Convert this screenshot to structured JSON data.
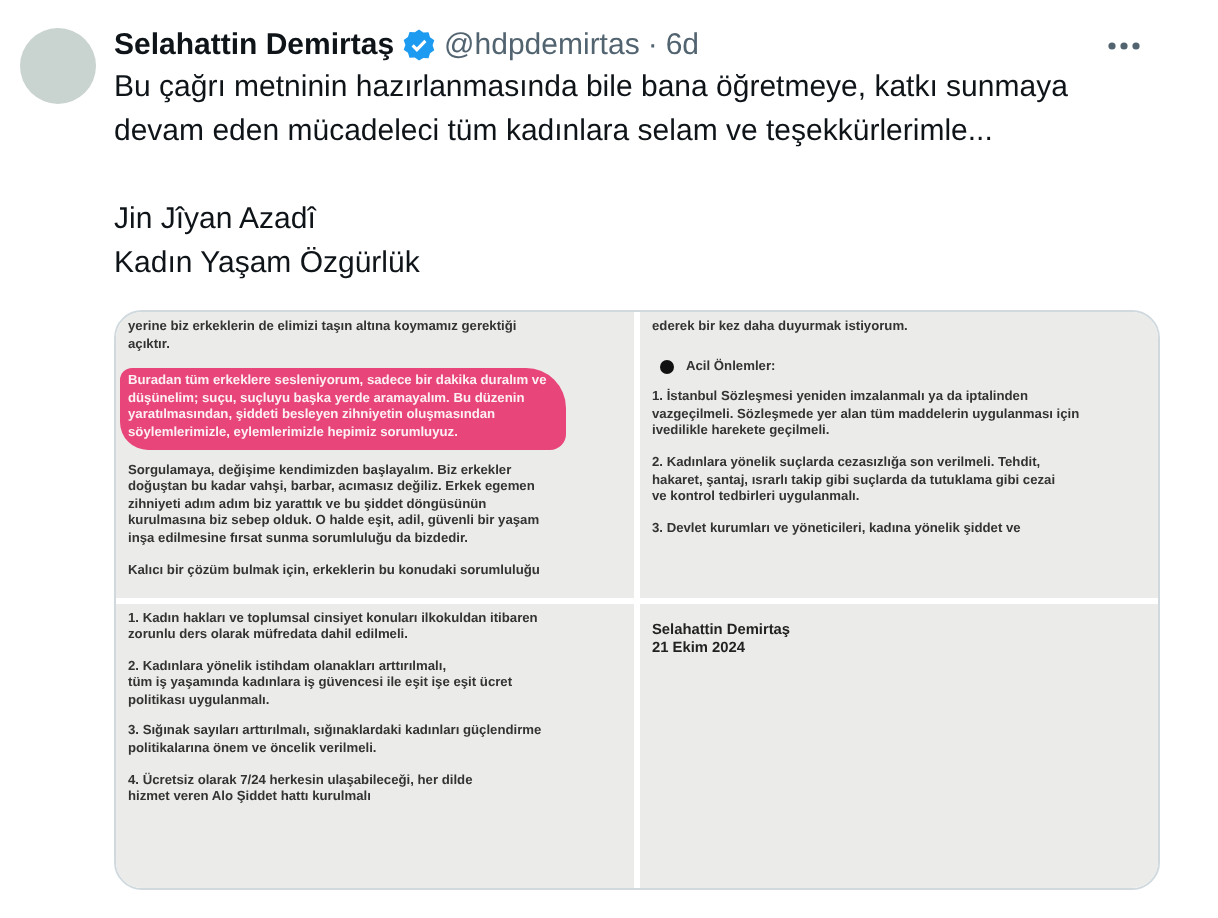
{
  "author": {
    "name": "Selahattin Demirtaş",
    "verified": true,
    "handle": "@hdpdemirtas",
    "separator": "·",
    "time": "6d"
  },
  "text": [
    [
      "Bu çağrı metninin hazırlanmasında bile bana öğretmeye, katkı sunmaya devam eden mücadeleci tüm kadınlara selam ve teşekkürlerimle..."
    ],
    [
      "Jin Jîyan Azadî",
      "Kadın Yaşam Özgürlük"
    ]
  ],
  "media": {
    "panels": [
      {
        "paragraphs": [
          {
            "kind": "text",
            "lines": [
              "yerine biz erkeklerin de elimizi taşın altına koymamız gerektiği",
              "açıktır."
            ]
          },
          {
            "kind": "highlight",
            "lines": [
              "Buradan tüm erkeklere sesleniyorum, sadece bir dakika duralım ve",
              "düşünelim; suçu, suçluyu başka yerde aramayalım. Bu düzenin",
              "yaratılmasından, şiddeti besleyen zihniyetin oluşmasından",
              "söylemlerimizle, eylemlerimizle hepimiz sorumluyuz."
            ]
          },
          {
            "kind": "text",
            "lines": [
              "Sorgulamaya, değişime kendimizden başlayalım. Biz erkekler",
              "doğuştan bu kadar vahşi, barbar, acımasız değiliz. Erkek egemen",
              "zihniyeti adım adım biz yarattık ve bu şiddet döngüsünün",
              "kurulmasına biz sebep olduk. O halde eşit, adil, güvenli bir yaşam",
              "inşa edilmesine fırsat sunma sorumluluğu da bizdedir."
            ]
          },
          {
            "kind": "text",
            "lines": [
              "Kalıcı bir çözüm bulmak için, erkeklerin bu konudaki sorumluluğu"
            ]
          }
        ]
      },
      {
        "paragraphs": [
          {
            "kind": "text",
            "lines": [
              "ederek bir kez daha duyurmak istiyorum."
            ]
          },
          {
            "kind": "bullet",
            "lines": [
              "Acil Önlemler:"
            ]
          },
          {
            "kind": "text",
            "lines": [
              "1. İstanbul Sözleşmesi yeniden imzalanmalı ya da iptalinden",
              "vazgeçilmeli. Sözleşmede yer alan tüm maddelerin uygulanması için",
              "ivedilikle harekete geçilmeli."
            ]
          },
          {
            "kind": "text",
            "lines": [
              "2. Kadınlara yönelik suçlarda cezasızlığa son verilmeli. Tehdit,",
              "hakaret, şantaj, ısrarlı takip gibi suçlarda da tutuklama gibi cezai",
              "ve kontrol tedbirleri uygulanmalı."
            ]
          },
          {
            "kind": "text",
            "lines": [
              "3. Devlet kurumları ve yöneticileri, kadına yönelik şiddet ve"
            ]
          }
        ]
      },
      {
        "paragraphs": [
          {
            "kind": "text",
            "lines": [
              "1. Kadın hakları ve toplumsal cinsiyet konuları ilkokuldan itibaren",
              "zorunlu ders olarak müfredata dahil edilmeli."
            ]
          },
          {
            "kind": "text",
            "lines": [
              "2. Kadınlara yönelik istihdam olanakları arttırılmalı,",
              "tüm iş yaşamında kadınlara iş güvencesi ile eşit işe eşit ücret",
              "politikası uygulanmalı."
            ]
          },
          {
            "kind": "text",
            "lines": [
              "3. Sığınak sayıları arttırılmalı, sığınaklardaki kadınları güçlendirme",
              "politikalarına önem ve öncelik verilmeli."
            ]
          },
          {
            "kind": "text",
            "lines": [
              "4. Ücretsiz olarak 7/24 herkesin ulaşabileceği, her dilde",
              "hizmet veren Alo Şiddet hattı kurulmalı"
            ]
          }
        ]
      },
      {
        "paragraphs": [
          {
            "kind": "signature",
            "lines": [
              "Selahattin Demirtaş",
              "21 Ekim 2024"
            ]
          }
        ]
      }
    ]
  }
}
